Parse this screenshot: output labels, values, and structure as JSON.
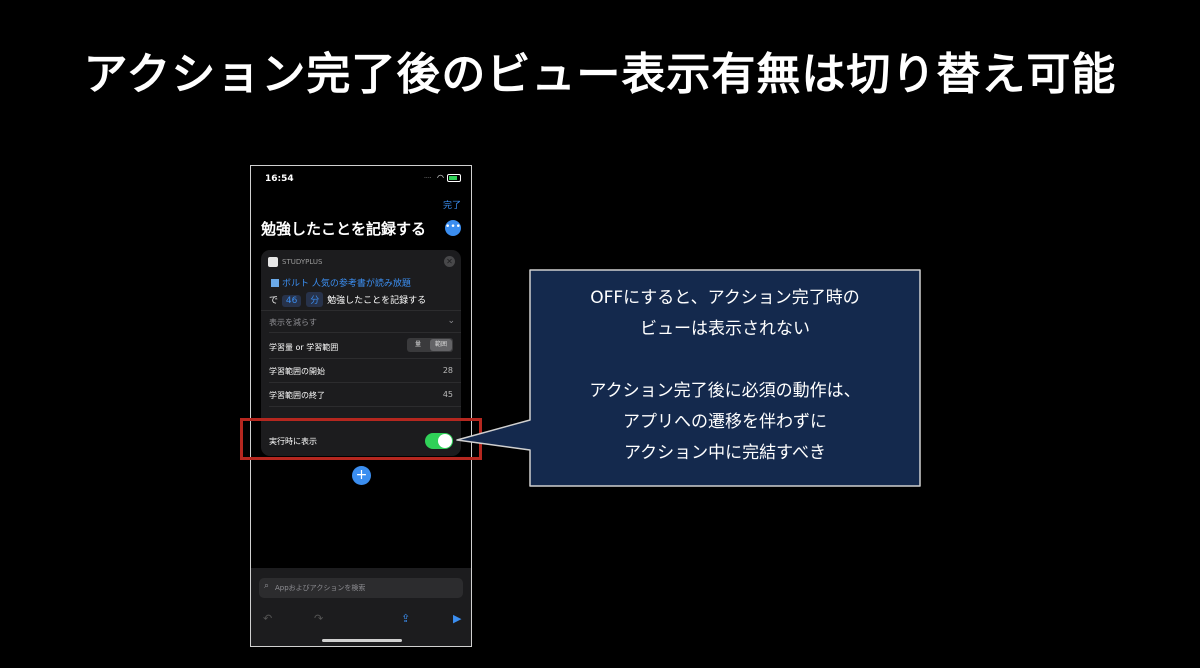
{
  "slide": {
    "title": "アクション完了後のビュー表示有無は切り替え可能"
  },
  "phone": {
    "status_time": "16:54",
    "done_label": "完了",
    "shortcut_title": "勉強したことを記録する",
    "more_icon": "ellipsis-icon",
    "card": {
      "app_name": "STUDYPLUS",
      "book": "ボルト 人気の参考書が読み放題",
      "prefix": "で",
      "minutes": "46",
      "unit": "分",
      "action": "勉強したことを記録する",
      "collapse_label": "表示を減らす",
      "params": [
        {
          "label": "学習量 or 学習範囲",
          "seg": [
            "量",
            "範囲"
          ],
          "selected": "範囲"
        },
        {
          "label": "学習範囲の開始",
          "value": "28"
        },
        {
          "label": "学習範囲の終了",
          "value": "45"
        }
      ],
      "toggle_label": "実行時に表示",
      "toggle_on": true
    },
    "search_placeholder": "Appおよびアクションを検索"
  },
  "callout": {
    "line1": "OFFにすると、アクション完了時の",
    "line2": "ビューは表示されない",
    "line3": "アクション完了後に必須の動作は、",
    "line4": "アプリへの遷移を伴わずに",
    "line5": "アクション中に完結すべき"
  },
  "colors": {
    "accent": "#3b8ef0",
    "toggle_on": "#30d158",
    "highlight": "#b5271f",
    "callout_bg": "#14294d"
  }
}
